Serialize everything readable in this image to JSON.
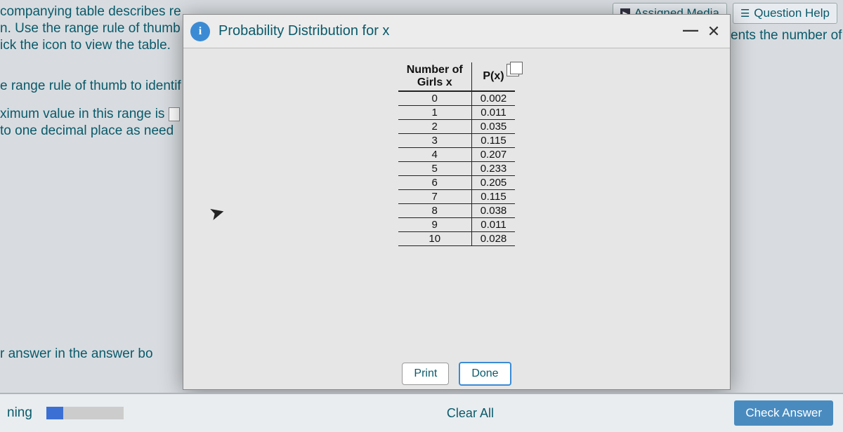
{
  "top": {
    "assigned_media": "Assigned Media",
    "question_help": "Question Help"
  },
  "bg": {
    "line1": "companying table describes re",
    "line2": "n. Use the range rule of thumb",
    "line3": "ick the icon to view the table.",
    "line4": "e range rule of thumb to identif",
    "line5": "ximum value in this range is",
    "line6": "to one decimal place as need",
    "line7": "r answer in the answer bo",
    "right_text": "ents the number of girls among"
  },
  "modal": {
    "title": "Probability Distribution for x",
    "info": "i",
    "min": "—",
    "close": "✕",
    "col1": "Number of Girls x",
    "col2": "P(x)",
    "rows": [
      {
        "x": "0",
        "p": "0.002"
      },
      {
        "x": "1",
        "p": "0.011"
      },
      {
        "x": "2",
        "p": "0.035"
      },
      {
        "x": "3",
        "p": "0.115"
      },
      {
        "x": "4",
        "p": "0.207"
      },
      {
        "x": "5",
        "p": "0.233"
      },
      {
        "x": "6",
        "p": "0.205"
      },
      {
        "x": "7",
        "p": "0.115"
      },
      {
        "x": "8",
        "p": "0.038"
      },
      {
        "x": "9",
        "p": "0.011"
      },
      {
        "x": "10",
        "p": "0.028"
      }
    ],
    "print": "Print",
    "done": "Done"
  },
  "bottom": {
    "left": "ning",
    "clear": "Clear All",
    "check": "Check Answer",
    "back": "◀"
  },
  "chart_data": {
    "type": "table",
    "title": "Probability Distribution for x",
    "columns": [
      "Number of Girls x",
      "P(x)"
    ],
    "rows": [
      [
        0,
        0.002
      ],
      [
        1,
        0.011
      ],
      [
        2,
        0.035
      ],
      [
        3,
        0.115
      ],
      [
        4,
        0.207
      ],
      [
        5,
        0.233
      ],
      [
        6,
        0.205
      ],
      [
        7,
        0.115
      ],
      [
        8,
        0.038
      ],
      [
        9,
        0.011
      ],
      [
        10,
        0.028
      ]
    ]
  }
}
